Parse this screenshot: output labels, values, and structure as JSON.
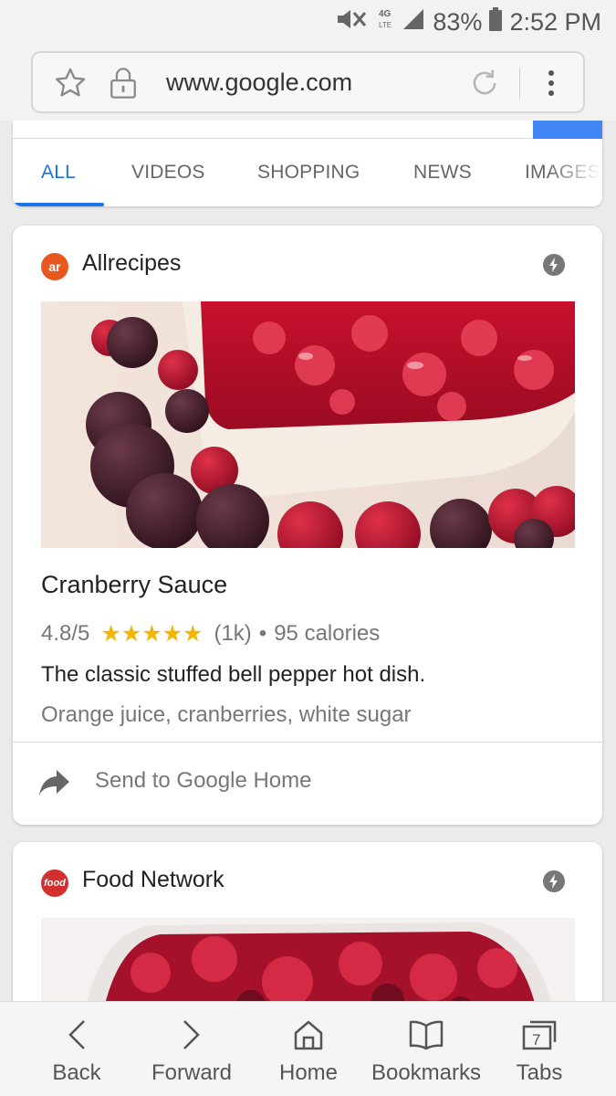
{
  "status_bar": {
    "battery": "83%",
    "time": "2:52 PM",
    "network": "4G LTE"
  },
  "browser": {
    "url": "www.google.com"
  },
  "search_tabs": [
    {
      "label": "ALL",
      "active": true
    },
    {
      "label": "VIDEOS",
      "active": false
    },
    {
      "label": "SHOPPING",
      "active": false
    },
    {
      "label": "NEWS",
      "active": false
    },
    {
      "label": "IMAGES",
      "active": false
    }
  ],
  "results": [
    {
      "source": "Allrecipes",
      "logo_text": "ar",
      "logo_color": "#e8571e",
      "title": "Cranberry Sauce",
      "rating": "4.8/5",
      "stars": "★★★★★",
      "reviews": "(1k)",
      "separator": "•",
      "calories": "95 calories",
      "description": "The classic stuffed bell pepper hot dish.",
      "ingredients": "Orange juice, cranberries, white sugar",
      "send_label": "Send to Google Home"
    },
    {
      "source": "Food Network",
      "logo_text": "food",
      "logo_color": "#d32f2f"
    }
  ],
  "bottom_nav": {
    "back": "Back",
    "forward": "Forward",
    "home": "Home",
    "bookmarks": "Bookmarks",
    "tabs": "Tabs",
    "tab_count": "7"
  },
  "colors": {
    "accent": "#1a73e8",
    "star": "#f4b400"
  }
}
